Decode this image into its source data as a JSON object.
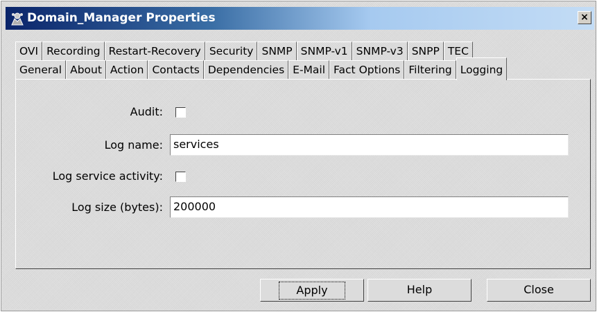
{
  "window": {
    "title": "Domain_Manager Properties",
    "close_label": "×"
  },
  "tabs": {
    "back_row": [
      "OVI",
      "Recording",
      "Restart-Recovery",
      "Security",
      "SNMP",
      "SNMP-v1",
      "SNMP-v3",
      "SNPP",
      "TEC"
    ],
    "front_row": [
      "General",
      "About",
      "Action",
      "Contacts",
      "Dependencies",
      "E-Mail",
      "Fact Options",
      "Filtering",
      "Logging"
    ],
    "active": "Logging"
  },
  "form": {
    "audit_label": "Audit:",
    "audit_checked": false,
    "log_name_label": "Log name:",
    "log_name_value": "services",
    "log_service_activity_label": "Log service activity:",
    "log_service_activity_checked": false,
    "log_size_label": "Log size (bytes):",
    "log_size_value": "200000"
  },
  "buttons": {
    "apply": "Apply",
    "help": "Help",
    "close": "Close"
  },
  "colors": {
    "title_gradient_start": "#0a246a",
    "title_gradient_end": "#c3dcf5",
    "window_bg": "#dcdcdc"
  }
}
